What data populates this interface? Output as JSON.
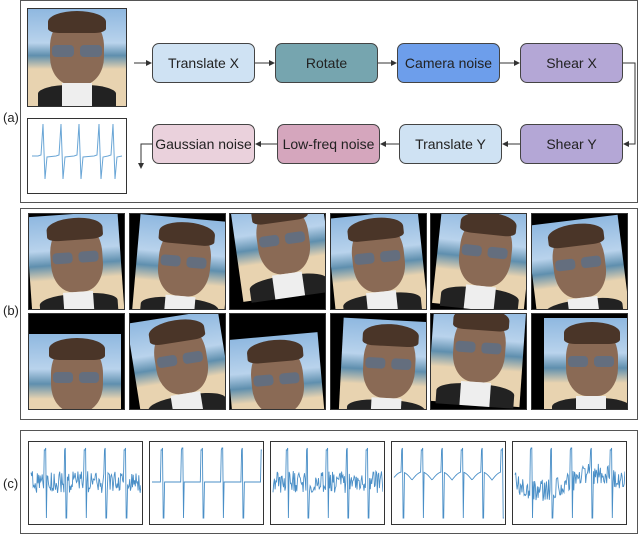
{
  "panel_labels": {
    "a": "(a)",
    "b": "(b)",
    "c": "(c)"
  },
  "pipeline": [
    {
      "label": "Translate X",
      "color": "#cfe2f3"
    },
    {
      "label": "Rotate",
      "color": "#76a5af"
    },
    {
      "label": "Camera noise",
      "color": "#6d9eeb"
    },
    {
      "label": "Shear X",
      "color": "#b4a7d6"
    },
    {
      "label": "Shear Y",
      "color": "#b4a7d6"
    },
    {
      "label": "Translate Y",
      "color": "#cfe2f3"
    },
    {
      "label": "Low-freq noise",
      "color": "#d5a6bd"
    },
    {
      "label": "Gaussian noise",
      "color": "#ead1dc"
    }
  ],
  "input_image": "face-photo",
  "input_signal": "clean-periodic-pulse",
  "augmented_images": {
    "rows": 2,
    "cols": 6,
    "description": "augmented face photos"
  },
  "augmented_signals": [
    "noisy",
    "clean-shifted",
    "noisy",
    "low-freq-drift",
    "noisy-drift"
  ],
  "line_color": "#4a8fc7"
}
